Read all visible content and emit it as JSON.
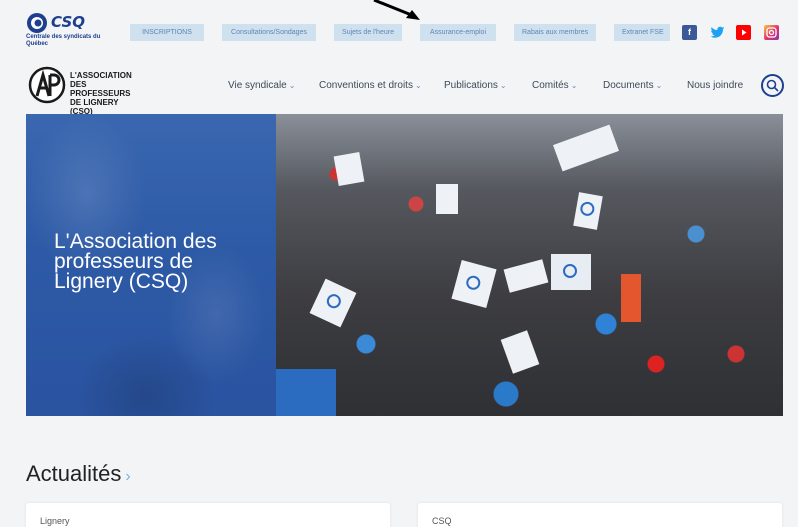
{
  "csq": {
    "logo_text": "CSQ",
    "subtitle": "Centrale des syndicats du Québec"
  },
  "top_links": [
    "INSCRIPTIONS",
    "Consultations/Sondages",
    "Sujets de l'heure",
    "Assurance-emploi",
    "Rabais aux membres",
    "Extranet FSE"
  ],
  "social": [
    {
      "name": "facebook-icon",
      "glyph": "f"
    },
    {
      "name": "twitter-icon",
      "glyph": "🐦"
    },
    {
      "name": "youtube-icon",
      "glyph": "▶"
    },
    {
      "name": "instagram-icon",
      "glyph": "◎"
    }
  ],
  "association": {
    "logo_name": "L'ASSOCIATION DES PROFESSEURS DE LIGNERY (CSQ)"
  },
  "menu": [
    {
      "label": "Vie syndicale",
      "dropdown": true
    },
    {
      "label": "Conventions et droits",
      "dropdown": true
    },
    {
      "label": "Publications",
      "dropdown": true
    },
    {
      "label": "Comités",
      "dropdown": true
    },
    {
      "label": "Documents",
      "dropdown": true
    },
    {
      "label": "Nous joindre",
      "dropdown": false
    }
  ],
  "hero": {
    "title": "L'Association des professeurs de Lignery (CSQ)"
  },
  "news": {
    "title": "Actualités",
    "chevron": "›",
    "cards": [
      "Lignery",
      "CSQ"
    ]
  },
  "colors": {
    "brand_blue": "#1d3f8e",
    "top_link_bg": "#cfe0ef",
    "hero_overlay": "#2d5aa6"
  }
}
